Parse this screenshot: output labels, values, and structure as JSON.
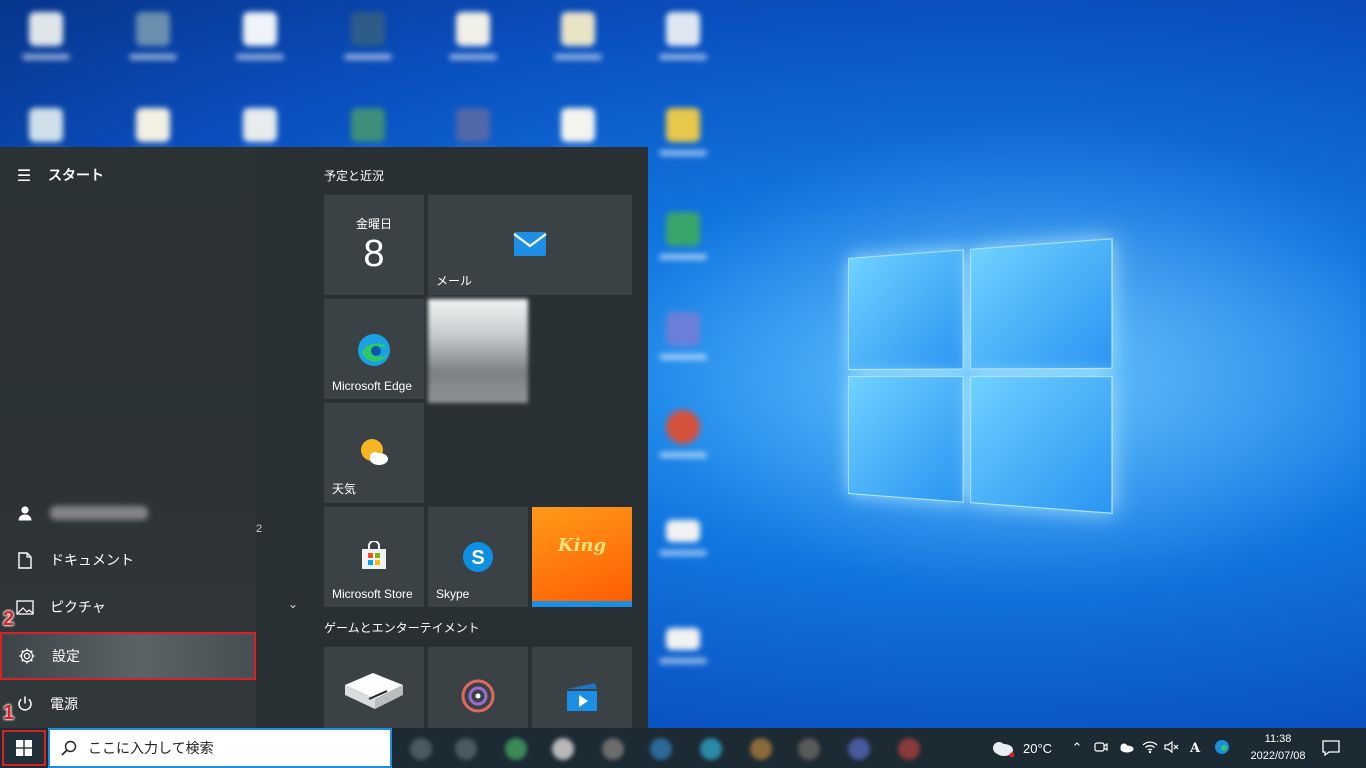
{
  "start_menu": {
    "title": "スタート",
    "rail": {
      "documents": "ドキュメント",
      "pictures": "ピクチャ",
      "settings": "設定",
      "power": "電源"
    },
    "list_letter": "2"
  },
  "tiles": {
    "group1_title": "予定と近況",
    "calendar_day": "金曜日",
    "calendar_date": "8",
    "mail": "メール",
    "edge": "Microsoft Edge",
    "weather": "天気",
    "store": "Microsoft Store",
    "skype": "Skype",
    "king": "King",
    "group2_title": "ゲームとエンターテイメント"
  },
  "annotations": {
    "step1": "1",
    "step2": "2"
  },
  "taskbar": {
    "search_placeholder": "ここに入力して検索",
    "temperature": "20°C",
    "ime": "A",
    "time": "11:38",
    "date": "2022/07/08"
  },
  "colors": {
    "highlight_border": "#d92226",
    "start_bg": "#283033",
    "tile_bg": "#3a4246",
    "taskbar_bg": "#1c2a33"
  }
}
